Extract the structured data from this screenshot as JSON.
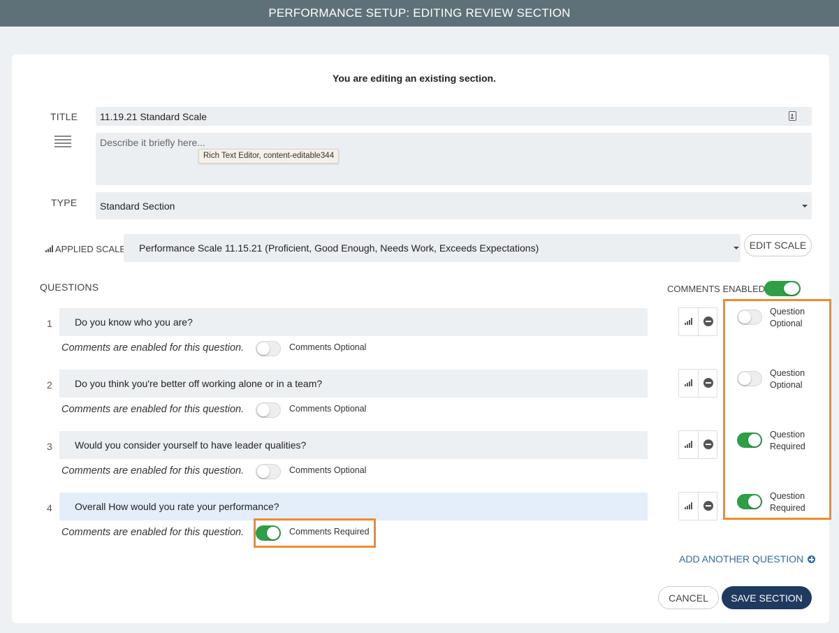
{
  "header": {
    "title": "PERFORMANCE SETUP: EDITING REVIEW SECTION"
  },
  "notice": "You are editing an existing section.",
  "form": {
    "title_label": "TITLE",
    "title_value": "11.19.21 Standard Scale",
    "description_placeholder": "Describe it briefly here...",
    "editor_tooltip": "Rich Text Editor, content-editable344",
    "type_label": "TYPE",
    "type_value": "Standard Section",
    "scale_label": "APPLIED SCALE",
    "scale_value": "Performance Scale 11.15.21 (Proficient, Good Enough, Needs Work, Exceeds Expectations)",
    "edit_scale_label": "EDIT SCALE"
  },
  "questions_label": "QUESTIONS",
  "comments_enabled_label": "COMMENTS ENABLED",
  "comments_enabled": true,
  "questions": [
    {
      "num": "1",
      "text": "Do you know who you are?",
      "note": "Comments are enabled for this question.",
      "comment_state": "Comments Optional",
      "comment_required": false,
      "req_line1": "Question",
      "req_line2": "Optional",
      "required": false
    },
    {
      "num": "2",
      "text": "Do you think you're better off working alone or in a team?",
      "note": "Comments are enabled for this question.",
      "comment_state": "Comments Optional",
      "comment_required": false,
      "req_line1": "Question",
      "req_line2": "Optional",
      "required": false
    },
    {
      "num": "3",
      "text": "Would you consider yourself to have leader qualities?",
      "note": "Comments are enabled for this question.",
      "comment_state": "Comments Optional",
      "comment_required": false,
      "req_line1": "Question",
      "req_line2": "Required",
      "required": true
    },
    {
      "num": "4",
      "text": "Overall How would you rate your performance?",
      "note": "Comments are enabled for this question.",
      "comment_state": "Comments Required",
      "comment_required": true,
      "req_line1": "Question",
      "req_line2": "Required",
      "required": true
    }
  ],
  "add_question_label": "ADD ANOTHER QUESTION",
  "cancel_label": "CANCEL",
  "save_label": "SAVE SECTION",
  "colors": {
    "header_bg": "#5e7178",
    "toggle_on": "#2e9e47",
    "highlight": "#f28a2b",
    "primary": "#1e3a5f",
    "link": "#2a6db0"
  }
}
